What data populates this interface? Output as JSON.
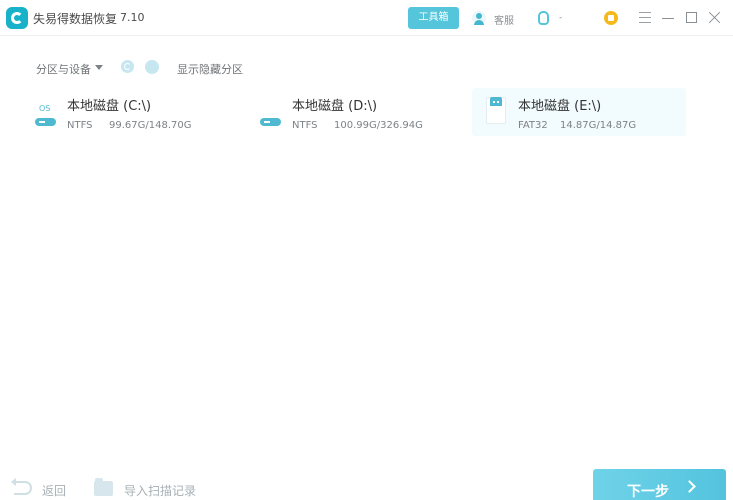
{
  "app": {
    "name": "失易得数据恢复",
    "version": "7.10"
  },
  "header": {
    "toolbox_label": "工具箱",
    "customer_service_label": "客服",
    "qq_label": "-"
  },
  "filter": {
    "dropdown_label": "分区与设备",
    "show_hidden_label": "显示隐藏分区"
  },
  "disks": [
    {
      "name": "本地磁盘 (C:\\)",
      "fs": "NTFS",
      "size": "99.67G/148.70G",
      "tag": "OS",
      "type": "hdd",
      "selected": false
    },
    {
      "name": "本地磁盘 (D:\\)",
      "fs": "NTFS",
      "size": "100.99G/326.94G",
      "type": "hdd",
      "selected": false
    },
    {
      "name": "本地磁盘 (E:\\)",
      "fs": "FAT32",
      "size": "14.87G/14.87G",
      "type": "usb",
      "selected": true
    }
  ],
  "footer": {
    "back_label": "返回",
    "import_label": "导入扫描记录",
    "next_label": "下一步"
  },
  "colors": {
    "accent": "#55c5dc",
    "selected_bg": "#f2fbfd",
    "vip": "#f5b91e"
  }
}
